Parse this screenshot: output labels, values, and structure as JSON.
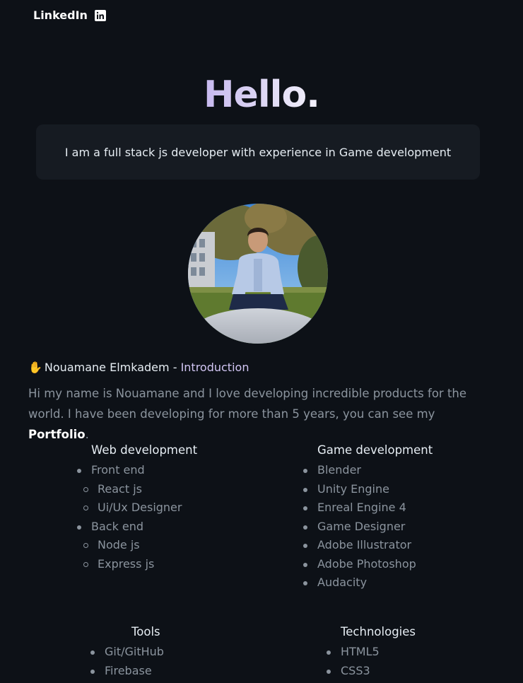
{
  "nav": {
    "linkedin_label": "LinkedIn",
    "linkedin_icon": "linkedin-icon"
  },
  "hero": {
    "greeting": "Hello.",
    "tagline": "I am a full stack js developer with experience in Game development"
  },
  "profile": {
    "photo": "profile-photo",
    "hand_emoji": "✋",
    "name": "Nouamane Elmkadem",
    "separator": " - ",
    "section": "Introduction",
    "intro_part1": "Hi my name is Nouamane and I love developing incredible products for the world. I have been developing for more than 5 years, you can see my ",
    "portfolio_link": "Portfolio",
    "intro_end": "."
  },
  "skills": {
    "web": {
      "title": "Web development",
      "front_end": "Front end",
      "react": "React js",
      "uiux": "Ui/Ux Designer",
      "back_end": "Back end",
      "node": "Node js",
      "express": "Express js"
    },
    "game": {
      "title": "Game development",
      "items": [
        "Blender",
        "Unity Engine",
        "Enreal Engine 4",
        "Game Designer",
        "Adobe Illustrator",
        "Adobe Photoshop",
        "Audacity"
      ]
    },
    "tools": {
      "title": "Tools",
      "items": [
        "Git/GitHub",
        "Firebase"
      ]
    },
    "tech": {
      "title": "Technologies",
      "items": [
        "HTML5",
        "CSS3"
      ]
    }
  },
  "colors": {
    "background": "#0d1117",
    "card": "#161b22",
    "accent": "#d2c6f4",
    "muted_text": "#8b949e"
  }
}
